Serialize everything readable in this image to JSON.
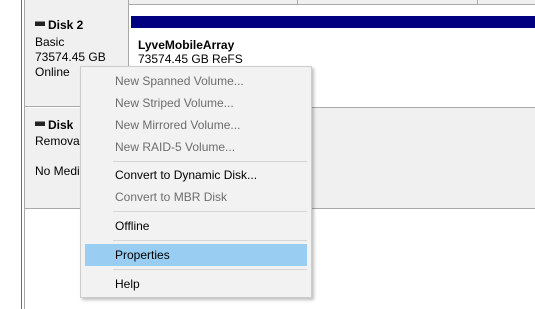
{
  "disk2": {
    "title": "Disk 2",
    "type": "Basic",
    "size": "73574.45 GB",
    "status": "Online"
  },
  "volume": {
    "name": "LyveMobileArray",
    "detail": "73574.45 GB ReFS",
    "bar_color": "#000080"
  },
  "disk3": {
    "title": "Disk",
    "type": "Removal",
    "status": "No Medi"
  },
  "context_menu": {
    "items": [
      {
        "label": "New Spanned Volume...",
        "enabled": false
      },
      {
        "label": "New Striped Volume...",
        "enabled": false
      },
      {
        "label": "New Mirrored Volume...",
        "enabled": false
      },
      {
        "label": "New RAID-5 Volume...",
        "enabled": false
      },
      {
        "label": "Convert to Dynamic Disk...",
        "enabled": true
      },
      {
        "label": "Convert to MBR Disk",
        "enabled": false
      },
      {
        "label": "Offline",
        "enabled": true
      },
      {
        "label": "Properties",
        "enabled": true,
        "highlighted": true
      },
      {
        "label": "Help",
        "enabled": true
      }
    ],
    "highlight_color": "#99cdf2"
  }
}
